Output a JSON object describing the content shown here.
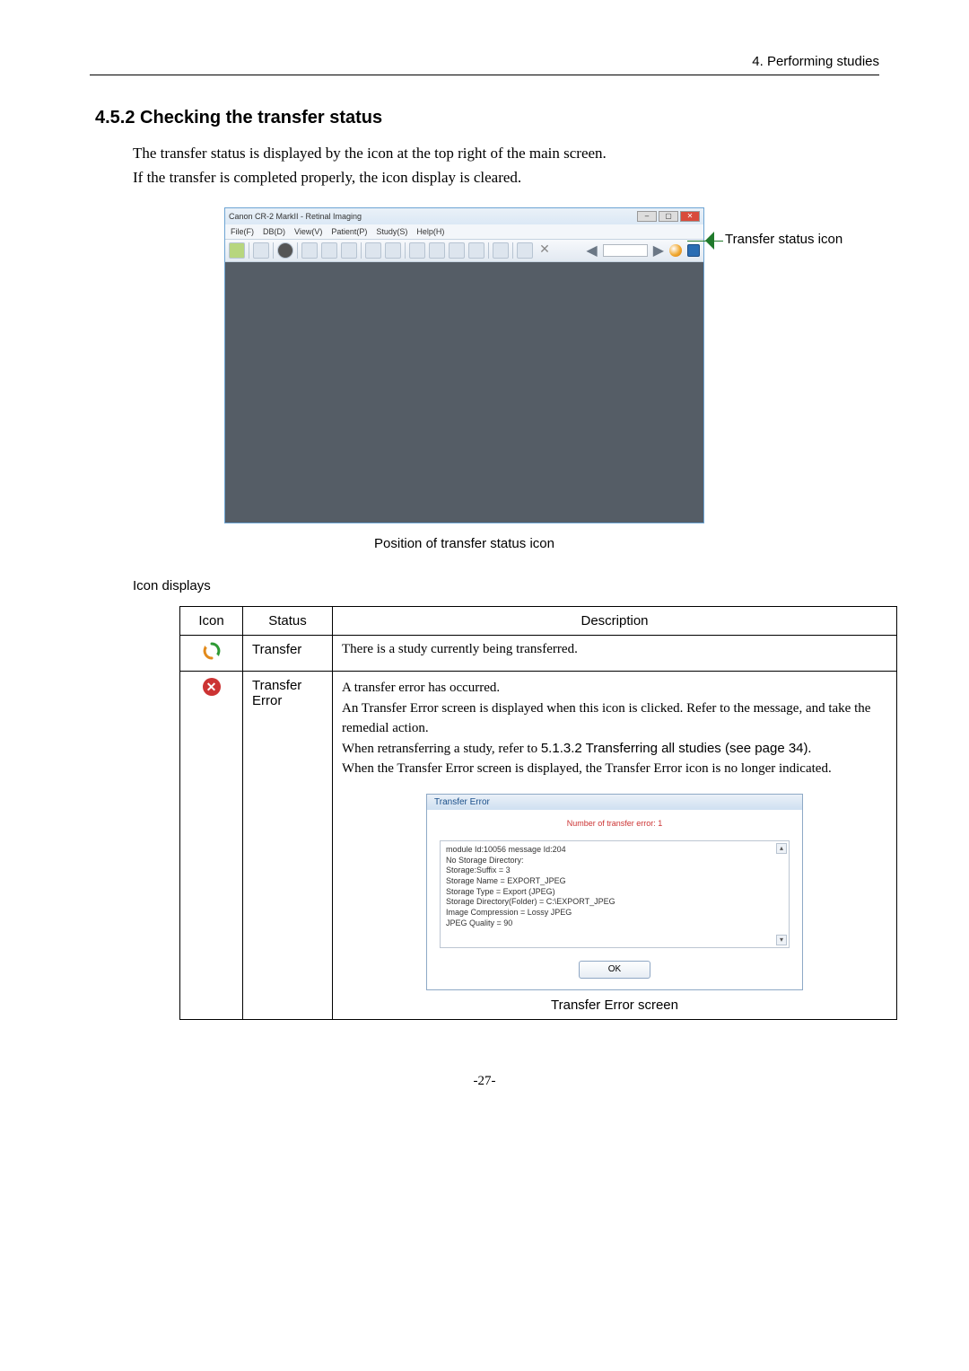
{
  "header": {
    "chapter": "4. Performing studies"
  },
  "section": {
    "number": "4.5.2",
    "title": "Checking the transfer status",
    "intro_line1": "The transfer status is displayed by the icon at the top right of the main screen.",
    "intro_line2": "If the transfer is completed properly, the icon display is cleared."
  },
  "figure1": {
    "app_title": "Canon CR-2 MarkII - Retinal Imaging",
    "menu": [
      "File(F)",
      "DB(D)",
      "View(V)",
      "Patient(P)",
      "Study(S)",
      "Help(H)"
    ],
    "callout_label": "Transfer status icon",
    "caption": "Position of transfer status icon"
  },
  "icon_displays_label": "Icon displays",
  "table": {
    "headers": {
      "icon": "Icon",
      "status": "Status",
      "description": "Description"
    },
    "row1": {
      "status": "Transfer",
      "desc": "There is a study currently being transferred."
    },
    "row2": {
      "status": "Transfer Error",
      "desc": {
        "l1": "A transfer error has occurred.",
        "l2": "An Transfer Error screen is displayed when this icon is clicked. Refer to the message, and take the remedial action.",
        "l3a": "When retransferring a study, refer to ",
        "l3b": "5.1.3.2 Transferring all studies (see page 34)",
        "l3c": ".",
        "l4": "When the Transfer Error screen is displayed, the Transfer Error icon is no longer indicated."
      },
      "dialog": {
        "title": "Transfer Error",
        "count": "Number of transfer error: 1",
        "msg": "module Id:10056 message Id:204\nNo Storage Directory:\nStorage:Suffix = 3\nStorage Name = EXPORT_JPEG\nStorage Type = Export (JPEG)\nStorage Directory(Folder) = C:\\EXPORT_JPEG\nImage Compression = Lossy JPEG\nJPEG Quality = 90",
        "ok": "OK",
        "caption": "Transfer Error screen"
      }
    }
  },
  "page_number": "-27-"
}
